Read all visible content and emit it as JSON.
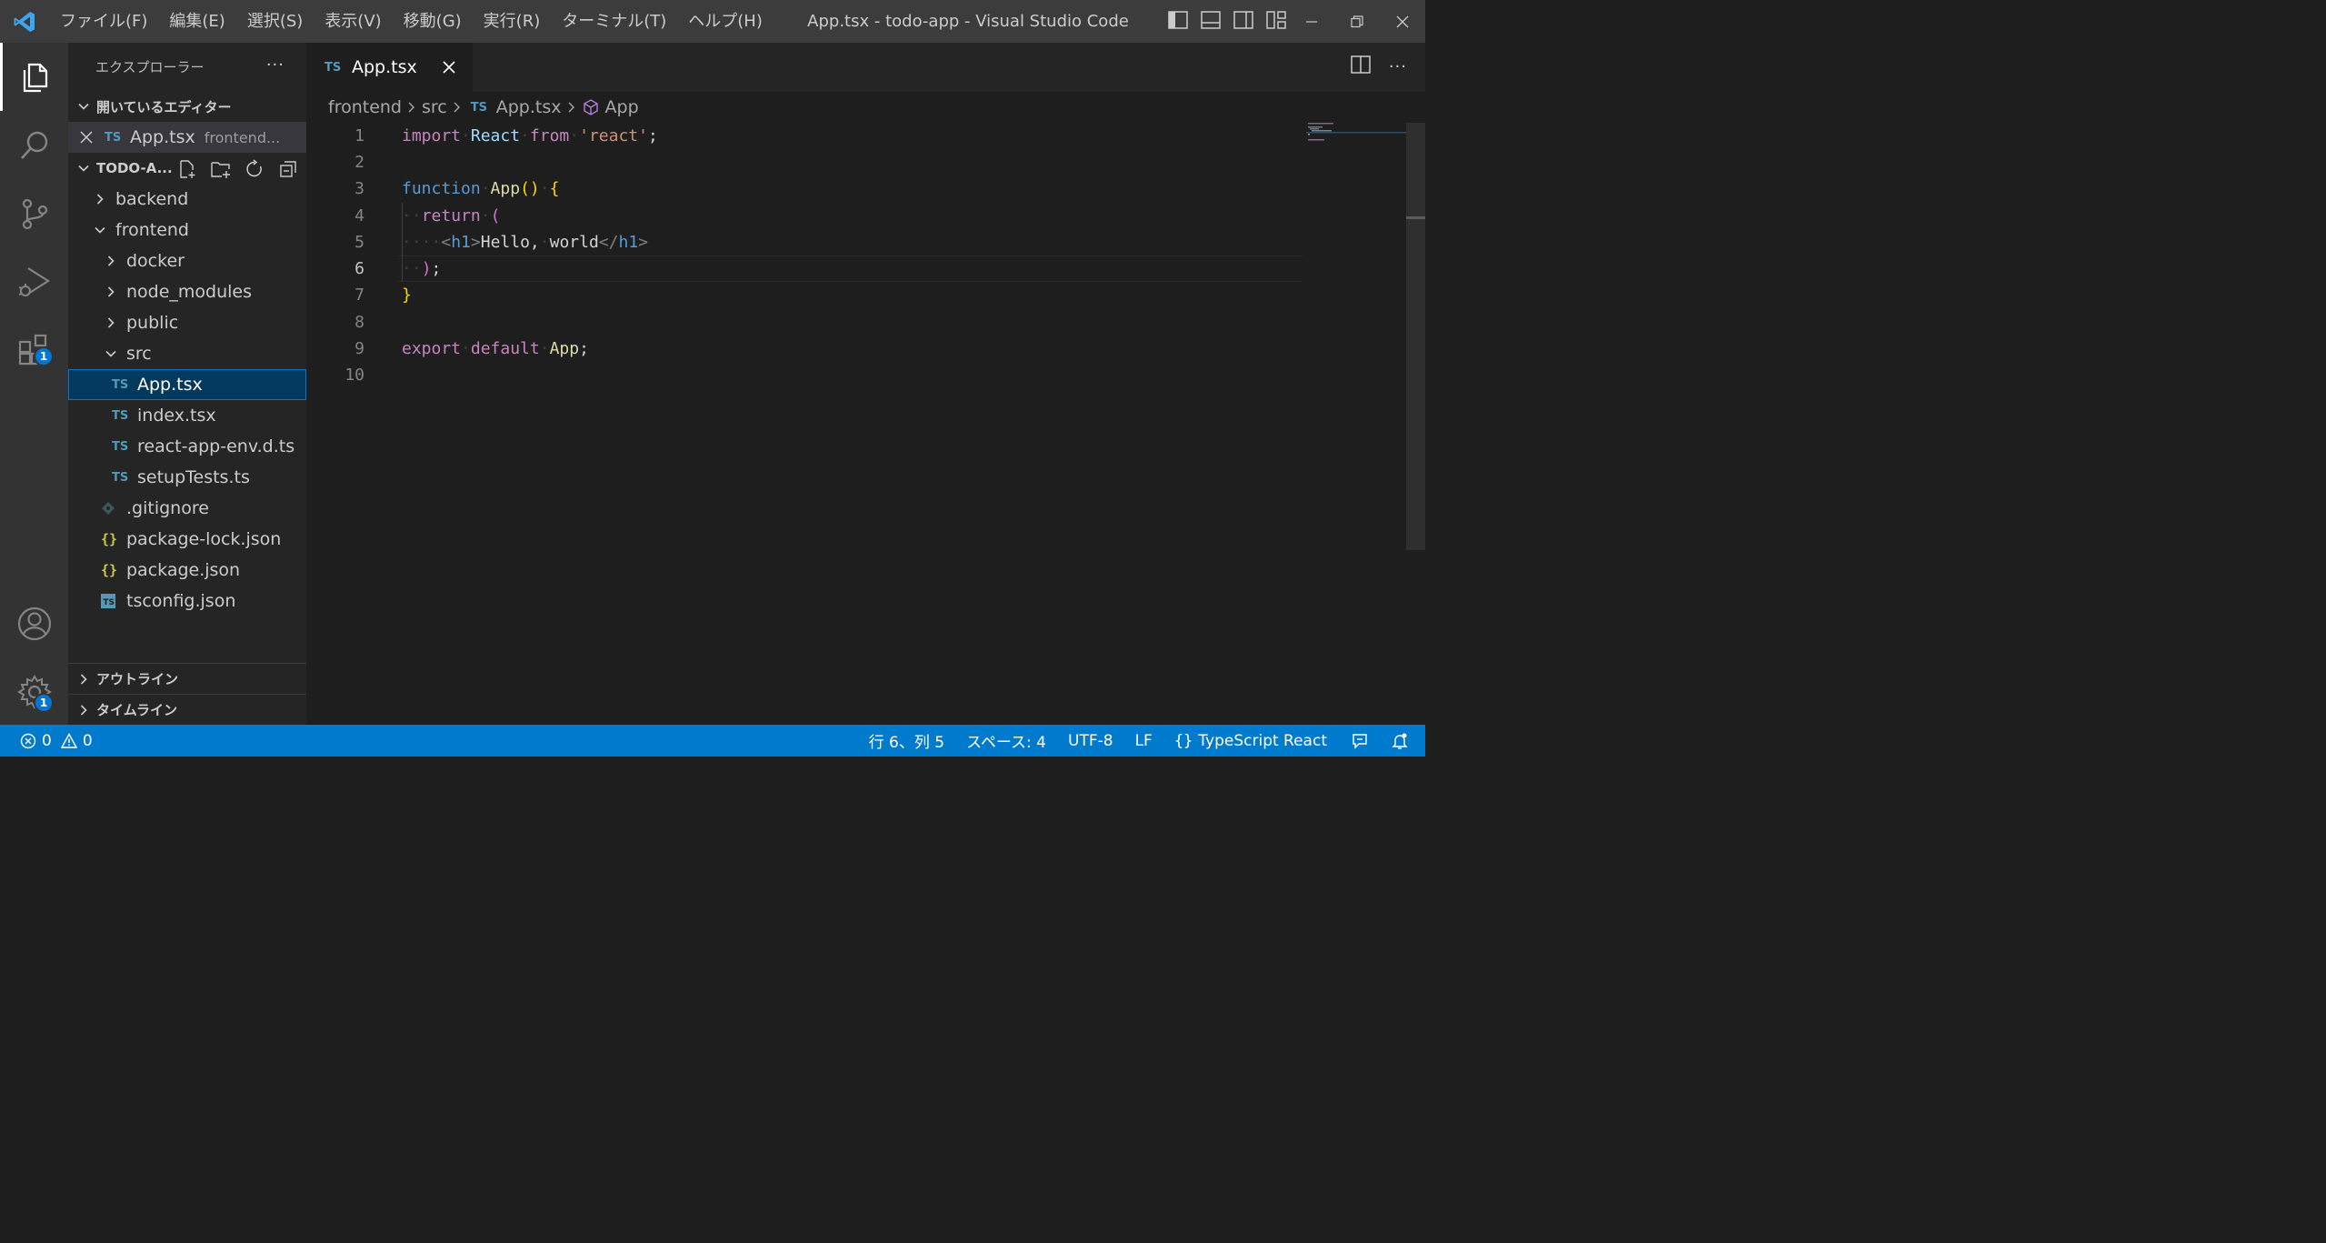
{
  "titlebar": {
    "menu": [
      "ファイル(F)",
      "編集(E)",
      "選択(S)",
      "表示(V)",
      "移動(G)",
      "実行(R)",
      "ターミナル(T)",
      "ヘルプ(H)"
    ],
    "window_title": "App.tsx - todo-app - Visual Studio Code"
  },
  "activitybar": {
    "extensions_badge": "1",
    "settings_badge": "1"
  },
  "sidebar": {
    "title": "エクスプローラー",
    "open_editors": {
      "label": "開いているエディター",
      "items": [
        {
          "icon": "TS",
          "name": "App.tsx",
          "path": "frontend..."
        }
      ]
    },
    "project": {
      "label": "TODO-A...",
      "tree": [
        {
          "name": "backend",
          "type": "folder"
        },
        {
          "name": "frontend",
          "type": "folder"
        },
        {
          "name": "docker",
          "type": "folder"
        },
        {
          "name": "node_modules",
          "type": "folder"
        },
        {
          "name": "public",
          "type": "folder"
        },
        {
          "name": "src",
          "type": "folder"
        },
        {
          "name": "App.tsx",
          "icon": "TS"
        },
        {
          "name": "index.tsx",
          "icon": "TS"
        },
        {
          "name": "react-app-env.d.ts",
          "icon": "TS"
        },
        {
          "name": "setupTests.ts",
          "icon": "TS"
        },
        {
          "name": ".gitignore",
          "icon": "git"
        },
        {
          "name": "package-lock.json",
          "icon": "{}"
        },
        {
          "name": "package.json",
          "icon": "{}"
        },
        {
          "name": "tsconfig.json",
          "icon": "TS"
        }
      ]
    },
    "outline_label": "アウトライン",
    "timeline_label": "タイムライン"
  },
  "editor": {
    "tab": {
      "icon": "TS",
      "label": "App.tsx"
    },
    "breadcrumb": [
      "frontend",
      "src",
      "App.tsx",
      "App"
    ],
    "line_numbers": [
      "1",
      "2",
      "3",
      "4",
      "5",
      "6",
      "7",
      "8",
      "9",
      "10"
    ],
    "current_line": "6",
    "code": [
      "import React from 'react';",
      "",
      "function App() {",
      "  return (",
      "    <h1>Hello, world</h1>",
      "  );",
      "}",
      "",
      "export default App;",
      ""
    ]
  },
  "statusbar": {
    "errors": "0",
    "warnings": "0",
    "cursor": "行 6、列 5",
    "indent": "スペース: 4",
    "encoding": "UTF-8",
    "eol": "LF",
    "language": "TypeScript React"
  },
  "colors": {
    "accent": "#007acc",
    "selection": "#04395e",
    "ts_icon": "#519aba",
    "json_icon": "#cbcb41"
  }
}
